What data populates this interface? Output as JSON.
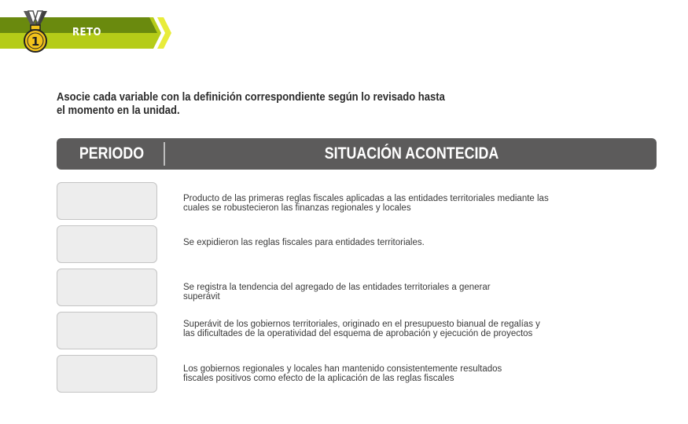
{
  "header": {
    "title": "RETO",
    "medal_number": "1"
  },
  "instructions": "Asocie cada variable con la definición correspondiente según lo revisado hasta el momento en la unidad.",
  "table": {
    "col_period": "PERIODO",
    "col_situation": "SITUACIÓN ACONTECIDA",
    "rows": [
      {
        "period": "",
        "situation": "Producto de las primeras reglas fiscales aplicadas a las entidades territoriales mediante las cuales se robustecieron las finanzas regionales y locales"
      },
      {
        "period": "",
        "situation": "Se expidieron las reglas fiscales para entidades territoriales."
      },
      {
        "period": "",
        "situation": "Se registra la tendencia del agregado de las entidades territoriales a generar superávit"
      },
      {
        "period": "",
        "situation": "Superávit de los gobiernos territoriales, originado en el presupuesto bianual de regalías y las dificultades de la operatividad del esquema de aprobación y ejecución de proyectos"
      },
      {
        "period": "",
        "situation": "Los gobiernos regionales y locales han mantenido consistentemente resultados fiscales positivos como efecto de la aplicación de las reglas fiscales"
      }
    ]
  },
  "colors": {
    "banner_green": "#b5cc18",
    "banner_dark": "#6a8a0e",
    "header_gray": "#5c5b5b",
    "medal_gold": "#f2c21b"
  }
}
